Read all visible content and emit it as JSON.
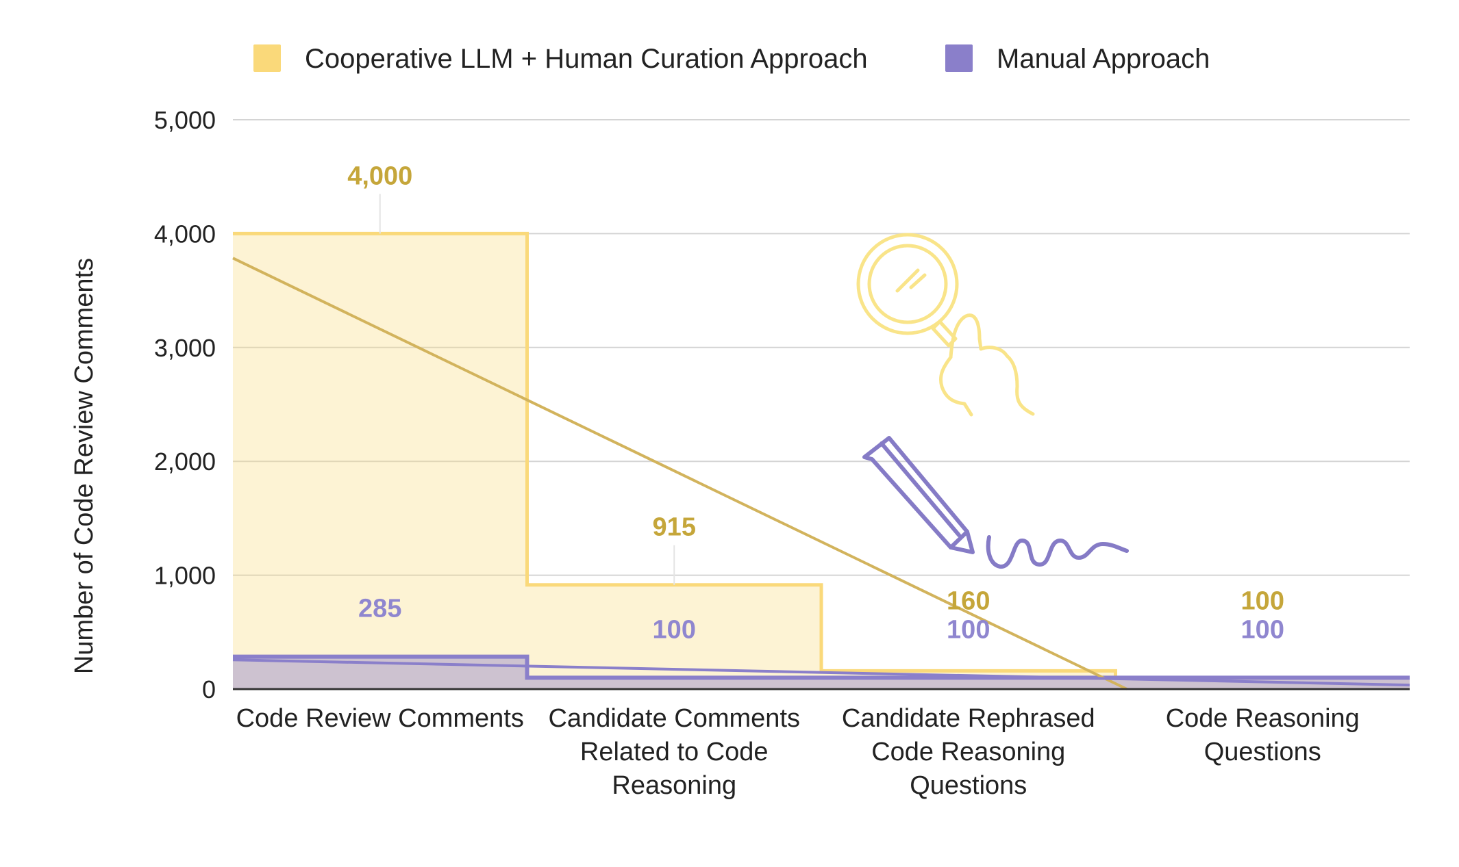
{
  "chart_data": {
    "type": "area",
    "stepped": true,
    "categories": [
      "Code Review Comments",
      "Candidate Comments Related to Code Reasoning",
      "Candidate Rephrased Code Reasoning Questions",
      "Code Reasoning Questions"
    ],
    "series": [
      {
        "name": "Cooperative LLM + Human Curation Approach",
        "values": [
          4000,
          915,
          160,
          100
        ],
        "color": "#fad97a",
        "label_color": "#c5a63a"
      },
      {
        "name": "Manual Approach",
        "values": [
          285,
          100,
          100,
          100
        ],
        "color": "#8a7fca",
        "label_color": "#8f86cf"
      }
    ],
    "ylabel": "Number of Code Review Comments",
    "xlabel": "",
    "ylim": [
      0,
      5000
    ],
    "yticks": [
      "0",
      "1,000",
      "2,000",
      "3,000",
      "4,000",
      "5,000"
    ],
    "data_labels": [
      [
        "4,000",
        "915",
        "160",
        "100"
      ],
      [
        "285",
        "100",
        "100",
        "100"
      ]
    ],
    "grid": true,
    "legend_position": "top",
    "trendline_color": "#d2b35c",
    "decorations": [
      "magnifier-hand-icon",
      "pencil-icon"
    ]
  }
}
